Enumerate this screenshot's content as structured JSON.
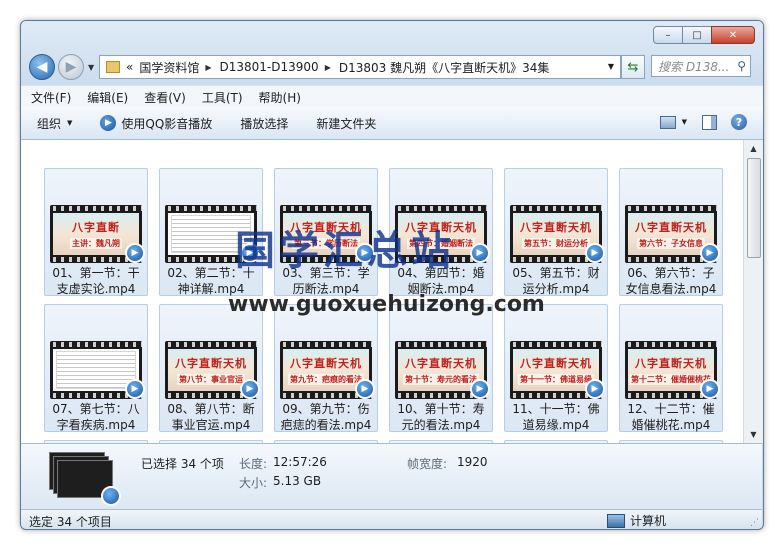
{
  "window": {
    "min_label": "–",
    "max_label": "□",
    "close_label": "✕"
  },
  "address": {
    "overflow": "«",
    "crumbs": [
      "国学资料馆",
      "D13801-D13900",
      "D13803 魏凡朔《八字直断天机》34集"
    ]
  },
  "search": {
    "placeholder": "搜索 D138..."
  },
  "menu": [
    "文件(F)",
    "编辑(E)",
    "查看(V)",
    "工具(T)",
    "帮助(H)"
  ],
  "toolbar": {
    "organize": "组织",
    "qq_play": "使用QQ影音播放",
    "slideshow": "播放选择",
    "new_folder": "新建文件夹"
  },
  "files": [
    {
      "label": "01、第一节：干支虚实论.mp4",
      "thumb_title": "八字直断",
      "thumb_sub": "主讲：魏凡朔",
      "kind": "video"
    },
    {
      "label": "02、第二节：十神详解.mp4",
      "thumb_title": "",
      "thumb_sub": "",
      "kind": "doc"
    },
    {
      "label": "03、第三节：学历断法.mp4",
      "thumb_title": "八字直断天机",
      "thumb_sub": "第三节：学历断法",
      "kind": "video"
    },
    {
      "label": "04、第四节：婚姻断法.mp4",
      "thumb_title": "八字直断天机",
      "thumb_sub": "第四节：婚姻断法",
      "kind": "video"
    },
    {
      "label": "05、第五节：财运分析.mp4",
      "thumb_title": "八字直断天机",
      "thumb_sub": "第五节：财运分析",
      "kind": "video"
    },
    {
      "label": "06、第六节：子女信息看法.mp4",
      "thumb_title": "八字直断天机",
      "thumb_sub": "第六节：子女信息",
      "kind": "video"
    },
    {
      "label": "07、第七节：八字看疾病.mp4",
      "thumb_title": "",
      "thumb_sub": "",
      "kind": "doc"
    },
    {
      "label": "08、第八节：断事业官运.mp4",
      "thumb_title": "八字直断天机",
      "thumb_sub": "第八节：事业官运",
      "kind": "video"
    },
    {
      "label": "09、第九节：伤疤痣的看法.mp4",
      "thumb_title": "八字直断天机",
      "thumb_sub": "第九节：疤痕的看法",
      "kind": "video"
    },
    {
      "label": "10、第十节：寿元的看法.mp4",
      "thumb_title": "八字直断天机",
      "thumb_sub": "第十节：寿元的看法",
      "kind": "video"
    },
    {
      "label": "11、十一节：佛道易缘.mp4",
      "thumb_title": "八字直断天机",
      "thumb_sub": "第十一节：佛道易缘",
      "kind": "video"
    },
    {
      "label": "12、十二节：催婚催桃花.mp4",
      "thumb_title": "八字直断天机",
      "thumb_sub": "第十二节：催婚催桃花",
      "kind": "video"
    }
  ],
  "watermark": {
    "cn": "国学汇总站",
    "en": "www.guoxuehuizong.com"
  },
  "details": {
    "selected": "已选择 34 个项",
    "length_key": "长度:",
    "length_val": "12:57:26",
    "size_key": "大小:",
    "size_val": "5.13 GB",
    "width_key": "帧宽度:",
    "width_val": "1920"
  },
  "status": {
    "left": "选定 34 个项目",
    "right": "计算机"
  }
}
